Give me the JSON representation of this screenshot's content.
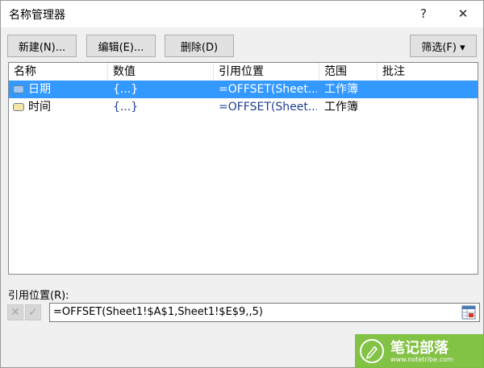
{
  "window": {
    "title": "名称管理器",
    "help_label": "?",
    "close_label": "✕"
  },
  "toolbar": {
    "new_label": "新建(N)...",
    "edit_label": "编辑(E)...",
    "delete_label": "删除(D)",
    "filter_label": "筛选(F) ▾"
  },
  "list": {
    "columns": [
      "名称",
      "数值",
      "引用位置",
      "范围",
      "批注"
    ],
    "rows": [
      {
        "name": "日期",
        "value": "{...}",
        "ref": "=OFFSET(Sheet...",
        "scope": "工作簿",
        "comment": "",
        "selected": true,
        "icon": "named-range-icon"
      },
      {
        "name": "时间",
        "value": "{...}",
        "ref": "=OFFSET(Sheet...",
        "scope": "工作簿",
        "comment": "",
        "selected": false,
        "icon": "named-range-icon"
      }
    ]
  },
  "refers_to": {
    "label": "引用位置(R):",
    "value": "=OFFSET(Sheet1!$A$1,Sheet1!$E$9,,5)",
    "cancel_icon": "cancel-x-icon",
    "confirm_icon": "confirm-check-icon",
    "collapse_icon": "range-select-icon"
  },
  "watermark": {
    "text": "笔记部落",
    "url": "www.notetribe.com"
  },
  "colors": {
    "selection": "#3399ff",
    "dialog_bg": "#f0f0f0",
    "watermark": "#7bbf3a"
  }
}
